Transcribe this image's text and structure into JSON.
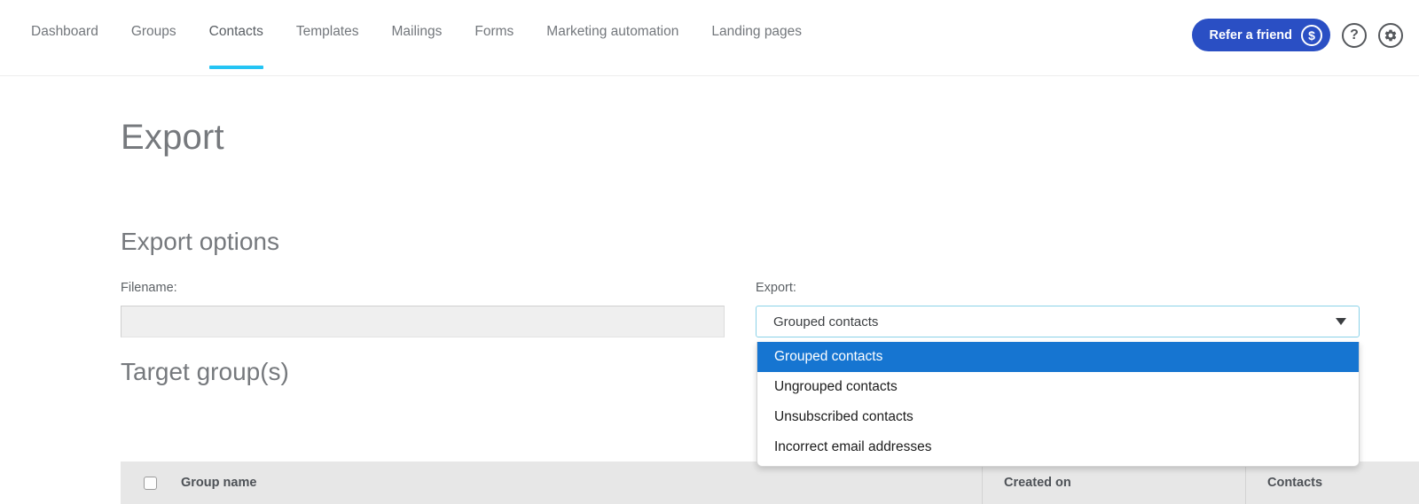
{
  "nav": {
    "items": [
      {
        "label": "Dashboard",
        "active": false
      },
      {
        "label": "Groups",
        "active": false
      },
      {
        "label": "Contacts",
        "active": true
      },
      {
        "label": "Templates",
        "active": false
      },
      {
        "label": "Mailings",
        "active": false
      },
      {
        "label": "Forms",
        "active": false
      },
      {
        "label": "Marketing automation",
        "active": false
      },
      {
        "label": "Landing pages",
        "active": false
      }
    ]
  },
  "topright": {
    "refer_label": "Refer a friend",
    "coin_glyph": "$",
    "help_glyph": "?",
    "settings_icon": "gear-icon"
  },
  "page": {
    "title": "Export",
    "section_title": "Export options",
    "target_title": "Target group(s)"
  },
  "form": {
    "filename_label": "Filename:",
    "filename_value": "",
    "filename_placeholder": "",
    "export_label": "Export:",
    "export_selected": "Grouped contacts",
    "export_options": [
      "Grouped contacts",
      "Ungrouped contacts",
      "Unsubscribed contacts",
      "Incorrect email addresses"
    ]
  },
  "table": {
    "columns": [
      "Group name",
      "Created on",
      "Contacts"
    ],
    "rows": []
  },
  "colors": {
    "accent_cyan": "#24c4f4",
    "brand_blue": "#2a4fc4",
    "option_highlight": "#1675d1",
    "select_border": "#8bd2e8",
    "table_header_bg": "#e7e7e7"
  }
}
